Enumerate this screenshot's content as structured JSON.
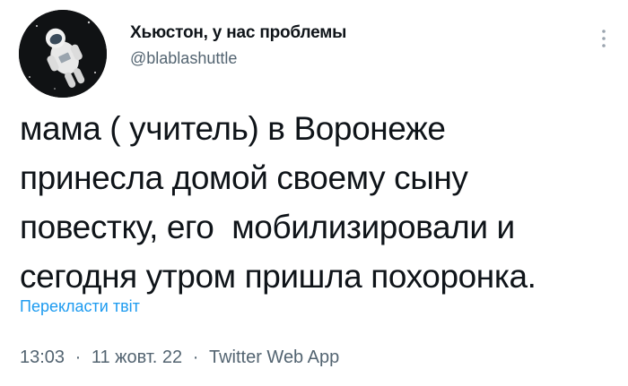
{
  "author": {
    "display_name": "Хьюстон, у нас проблемы",
    "handle": "@blablashuttle",
    "avatar_icon": "astronaut-avatar"
  },
  "more_icon": "vertical-dots-icon",
  "tweet": {
    "text": "мама ( учитель) в Воронеже\nпринесла домой своему сыну\nповестку, его  мобилизировали и\nсегодня утром пришла похоронка."
  },
  "translate_label": "Перекласти твіт",
  "meta": {
    "time": "13:03",
    "date": "11 жовт. 22",
    "separator": "·",
    "source": "Twitter Web App"
  },
  "colors": {
    "link": "#1d9bf0",
    "secondary": "#536471",
    "text": "#0f1419"
  }
}
